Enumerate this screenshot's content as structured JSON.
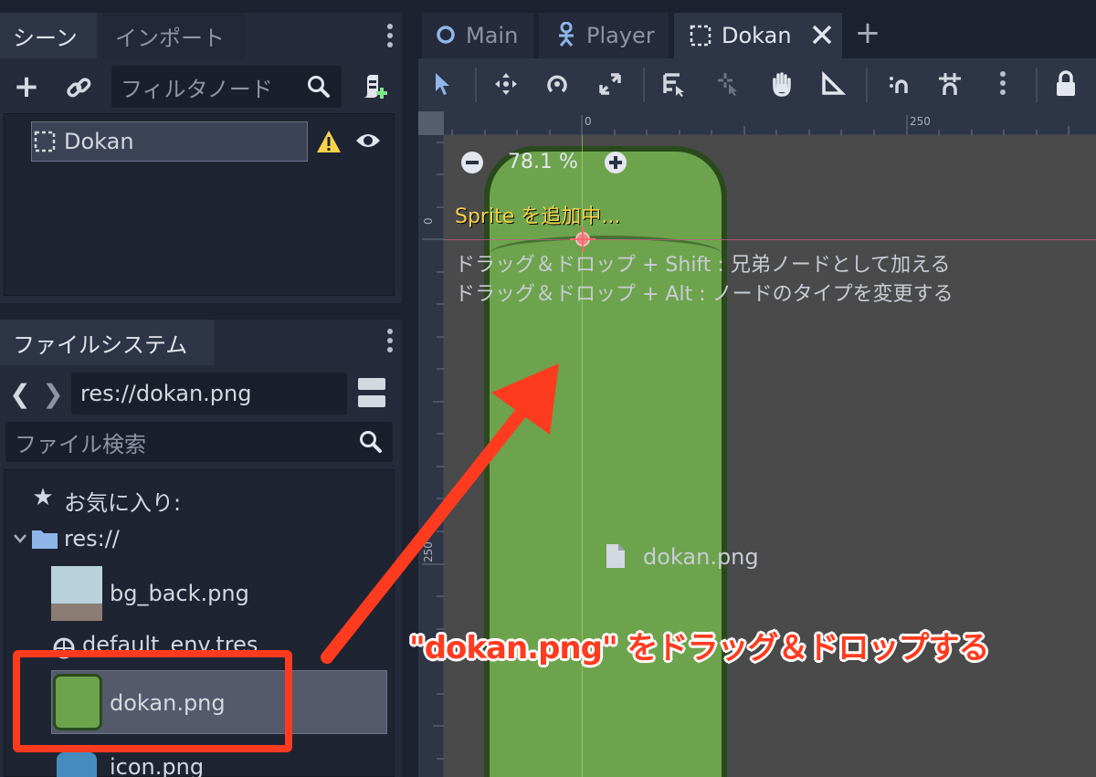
{
  "scene_dock": {
    "tabs": [
      "シーン",
      "インポート"
    ],
    "filter_placeholder": "フィルタノード",
    "root_node": "Dokan"
  },
  "filesystem_dock": {
    "tab": "ファイルシステム",
    "path": "res://dokan.png",
    "search_placeholder": "ファイル検索",
    "favorites": "お気に入り:",
    "root": "res://",
    "files": [
      "bg_back.png",
      "default_env.tres",
      "dokan.png",
      "icon.png"
    ]
  },
  "editor_tabs": [
    "Main",
    "Player",
    "Dokan"
  ],
  "viewport": {
    "zoom": "78.1 %",
    "status": "Sprite を追加中...",
    "hint1": "ドラッグ＆ドロップ + Shift : 兄弟ノードとして加える",
    "hint2": "ドラッグ＆ドロップ + Alt : ノードのタイプを変更する",
    "drag_file": "dokan.png",
    "ruler_top": [
      "0",
      "250"
    ],
    "ruler_left": [
      "0",
      "250"
    ]
  },
  "annotation": "\"dokan.png\" をドラッグ＆ドロップする",
  "colors": {
    "accent": "#ff3b1f",
    "pipe": "#6da34d",
    "pipe_dark": "#2a4a1c",
    "viewport": "#4a4a4a",
    "status": "#f7d34a"
  }
}
